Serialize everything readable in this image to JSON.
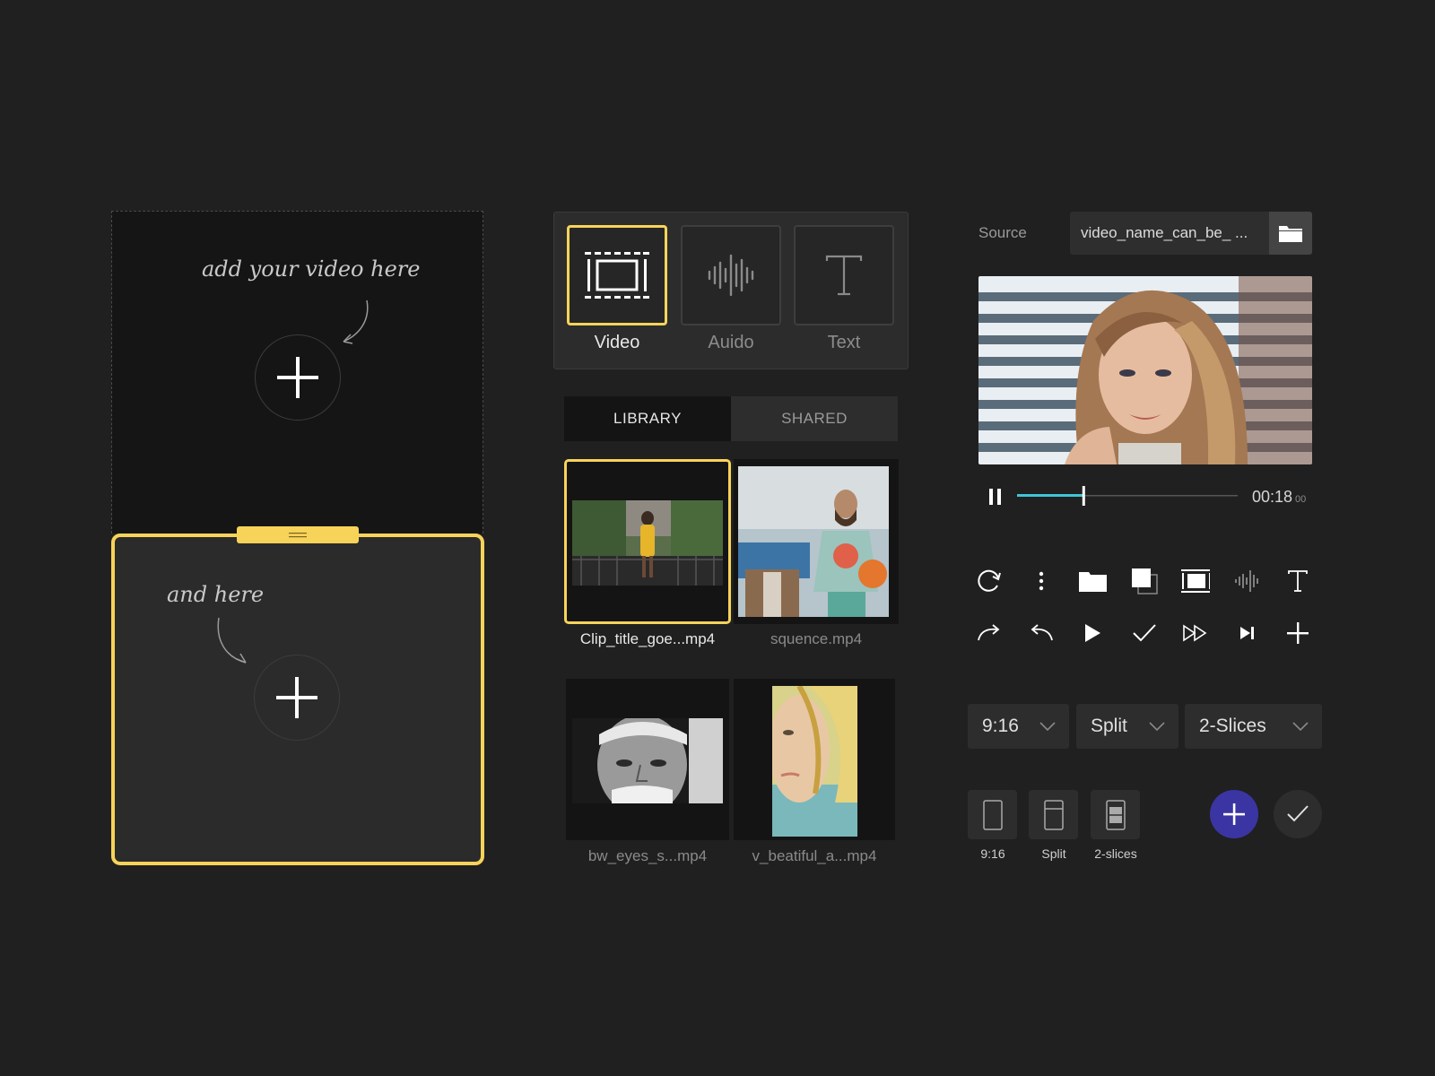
{
  "drop_zones": {
    "top_hint": "add your video here",
    "bottom_hint": "and here"
  },
  "media_types": [
    {
      "label": "Video",
      "icon": "film-frame-icon",
      "active": true
    },
    {
      "label": "Auido",
      "icon": "waveform-icon",
      "active": false
    },
    {
      "label": "Text",
      "icon": "text-t-icon",
      "active": false
    }
  ],
  "tabs": [
    {
      "label": "LIBRARY",
      "active": true
    },
    {
      "label": "SHARED",
      "active": false
    }
  ],
  "clips": [
    {
      "name": "Clip_title_goe...mp4",
      "selected": true
    },
    {
      "name": "squence.mp4",
      "selected": false
    },
    {
      "name": "bw_eyes_s...mp4",
      "selected": false
    },
    {
      "name": "v_beatiful_a...mp4",
      "selected": false
    }
  ],
  "source": {
    "label": "Source",
    "filename": "video_name_can_be_ ..."
  },
  "player": {
    "time": "00:18",
    "frames": "00",
    "progress": 0.3,
    "accent": "#3fc6d6"
  },
  "toolbar_row1": [
    "refresh-icon",
    "more-vertical-icon",
    "folder-icon",
    "layers-icon",
    "film-frame-icon",
    "waveform-icon",
    "text-t-icon"
  ],
  "toolbar_row2": [
    "redo-icon",
    "undo-icon",
    "play-icon",
    "check-icon",
    "fast-forward-icon",
    "skip-next-icon",
    "plus-icon"
  ],
  "dropdowns": {
    "ratio": "9:16",
    "mode": "Split",
    "slices": "2-Slices"
  },
  "layouts": [
    {
      "label": "9:16"
    },
    {
      "label": "Split"
    },
    {
      "label": "2-slices"
    }
  ],
  "colors": {
    "accent_yellow": "#f7d35a",
    "fab_blue": "#3b35a3",
    "background": "#202020"
  }
}
